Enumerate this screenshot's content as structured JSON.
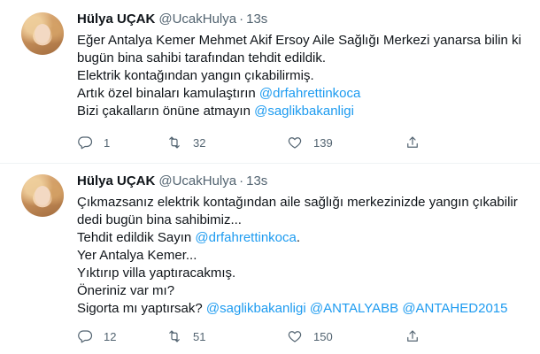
{
  "tweets": [
    {
      "author": {
        "display_name": "Hülya UÇAK",
        "handle": "@UcakHulya"
      },
      "separator": "·",
      "time": "13s",
      "lines": [
        [
          {
            "text": "Eğer Antalya Kemer Mehmet Akif Ersoy Aile Sağlığı Merkezi yanarsa bilin ki"
          }
        ],
        [
          {
            "text": "bugün bina sahibi tarafından tehdit edildik."
          }
        ],
        [
          {
            "text": "Elektrik kontağından yangın çıkabilirmiş."
          }
        ],
        [
          {
            "text": "Artık özel binaları kamulaştırın "
          },
          {
            "text": "@drfahrettinkoca",
            "mention": true
          }
        ],
        [
          {
            "text": "Bizi çakalların önüne atmayın "
          },
          {
            "text": "@saglikbakanligi",
            "mention": true
          }
        ]
      ],
      "stats": {
        "replies": "1",
        "retweets": "32",
        "likes": "139"
      }
    },
    {
      "author": {
        "display_name": "Hülya UÇAK",
        "handle": "@UcakHulya"
      },
      "separator": "·",
      "time": "13s",
      "lines": [
        [
          {
            "text": "Çıkmazsanız elektrik kontağından aile sağlığı merkezinizde yangın çıkabilir"
          }
        ],
        [
          {
            "text": "dedi bugün bina sahibimiz..."
          }
        ],
        [
          {
            "text": "Tehdit edildik Sayın "
          },
          {
            "text": "@drfahrettinkoca",
            "mention": true
          },
          {
            "text": "."
          }
        ],
        [
          {
            "text": "Yer Antalya Kemer..."
          }
        ],
        [
          {
            "text": "Yıktırıp villa yaptıracakmış."
          }
        ],
        [
          {
            "text": "Öneriniz var mı?"
          }
        ],
        [
          {
            "text": "Sigorta mı yaptırsak? "
          },
          {
            "text": "@saglikbakanligi",
            "mention": true
          },
          {
            "text": " "
          },
          {
            "text": "@ANTALYABB",
            "mention": true
          },
          {
            "text": " "
          },
          {
            "text": "@ANTAHED2015",
            "mention": true
          }
        ]
      ],
      "stats": {
        "replies": "12",
        "retweets": "51",
        "likes": "150"
      }
    }
  ],
  "icons": {
    "reply": "reply-icon",
    "retweet": "retweet-icon",
    "like": "like-icon",
    "share": "share-icon"
  },
  "colors": {
    "text": "#0f1419",
    "secondary": "#536471",
    "mention": "#1d9bf0",
    "divider": "#eff3f4"
  }
}
